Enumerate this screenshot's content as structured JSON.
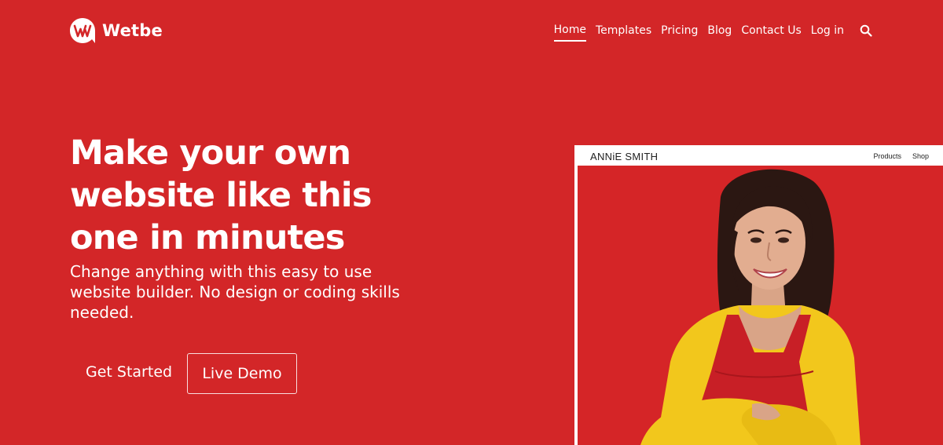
{
  "brand": {
    "name": "Wetbe",
    "logo_icon": "w-logo-icon"
  },
  "nav": {
    "items": [
      {
        "label": "Home",
        "active": true
      },
      {
        "label": "Templates"
      },
      {
        "label": "Pricing"
      },
      {
        "label": "Blog"
      },
      {
        "label": "Contact Us"
      },
      {
        "label": "Log in"
      }
    ],
    "search_icon": "search-icon"
  },
  "hero": {
    "title_lines": [
      "Make your own",
      "website like this",
      "one in minutes"
    ],
    "subtitle": "Change anything with this easy to use website builder. No design or coding skills needed.",
    "primary_cta": "Get Started",
    "secondary_cta": "Live Demo"
  },
  "preview": {
    "site_name": "ANNiE SMITH",
    "nav": [
      "Products",
      "Shop"
    ]
  },
  "colors": {
    "background": "#d32628",
    "text": "#ffffff",
    "sweater": "#f2c71c",
    "apron": "#c81f26"
  }
}
